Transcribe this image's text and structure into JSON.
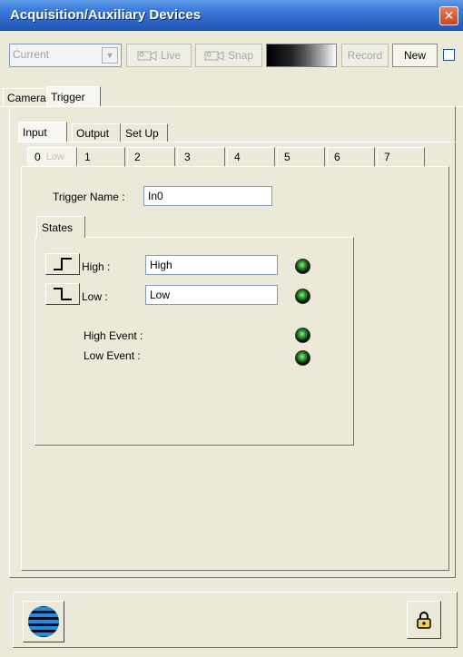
{
  "window": {
    "title": "Acquisition/Auxiliary Devices",
    "close_label": "✕"
  },
  "toolbar": {
    "combo_value": "Current",
    "live_label": "Live",
    "snap_label": "Snap",
    "record_label": "Record",
    "new_label": "New"
  },
  "outer_tabs": [
    "Camera",
    "Trigger"
  ],
  "sub_tabs": [
    "Input",
    "Output",
    "Set Up"
  ],
  "number_tabs": [
    "0",
    "1",
    "2",
    "3",
    "4",
    "5",
    "6",
    "7"
  ],
  "number_tab_ghost": "Low",
  "trigger": {
    "name_label": "Trigger Name :",
    "name_value": "In0",
    "states_tab": "States",
    "high_label": "High :",
    "high_value": "High",
    "low_label": "Low :",
    "low_value": "Low",
    "high_event_label": "High Event :",
    "low_event_label": "Low Event :"
  },
  "colors": {
    "title_bar": "#2c66c8",
    "panel_bg": "#ece9d8",
    "led": "#3aa83a"
  },
  "icons": [
    "camera-icon",
    "rising-edge-icon",
    "falling-edge-icon",
    "led-icon",
    "logo-icon",
    "lock-icon"
  ]
}
